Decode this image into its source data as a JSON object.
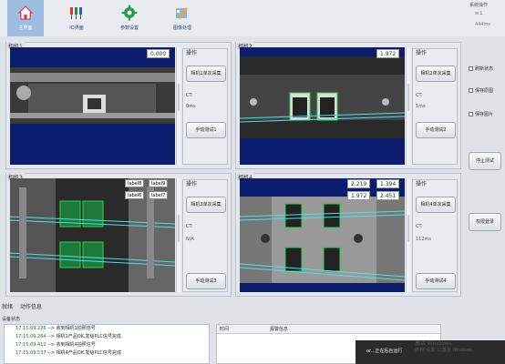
{
  "toolbar": {
    "items": [
      {
        "label": "主界面"
      },
      {
        "label": "IO界面"
      },
      {
        "label": "参数设置"
      },
      {
        "label": "图像处理"
      }
    ]
  },
  "sysop": {
    "title": "系统操作",
    "line1": "w.1",
    "line2": "444ms"
  },
  "cameras": [
    {
      "title": "相机1",
      "ops_title": "操作",
      "capture_btn": "相机1单次采集",
      "ct_label": "CT:",
      "ct_value": "0ms",
      "test_btn": "手动测试1",
      "value_box": "0.000"
    },
    {
      "title": "相机2",
      "ops_title": "操作",
      "capture_btn": "相机2单次采集",
      "ct_label": "CT:",
      "ct_value": "1ms",
      "test_btn": "手动测试2",
      "value_box": "1.972"
    },
    {
      "title": "相机3",
      "ops_title": "操作",
      "capture_btn": "相机3单次采集",
      "ct_label": "CT:",
      "ct_value": "N/A",
      "test_btn": "手动测试3",
      "labels": [
        "label8",
        "label9",
        "label6",
        "label7"
      ]
    },
    {
      "title": "相机4",
      "ops_title": "操作",
      "capture_btn": "相机4单次采集",
      "ct_label": "CT:",
      "ct_value": "112ms",
      "test_btn": "手动测试4",
      "values": [
        "2.219",
        "1.394",
        "1.972",
        "2.451"
      ]
    }
  ],
  "right": {
    "checks": [
      "刷新状态",
      "保存原图",
      "保存图片"
    ],
    "stop_btn": "停止测试",
    "login_btn": "权限登录"
  },
  "bottom": {
    "tab_ready": "就绪",
    "tab_action": "动作信息",
    "device_state": "设备状态",
    "logs": [
      {
        "time": "17:15:09.226",
        "msg": "-->  收到相机1拍照信号"
      },
      {
        "time": "17:15:09.264",
        "msg": "-->  相机1产品OK,发给PLC信号完成"
      },
      {
        "time": "17:15:09.412",
        "msg": "-->  收到相机4拍照信号"
      },
      {
        "time": "17:15:09.537",
        "msg": "-->  相机4产品OK,发给PLC信号完成"
      }
    ],
    "alarm_time_hdr": "时间",
    "alarm_info_hdr": "报警信息"
  },
  "notify": {
    "text": "or...正在后台运行"
  },
  "watermark": {
    "line1": "激活 Windows",
    "line2": "转到\"设置\"以激活 Windows。"
  },
  "colors": {
    "view_bg": "#0d1d6e",
    "accent": "#9fbde0",
    "roi": "#2ad24a",
    "line": "#4fe0e8"
  }
}
